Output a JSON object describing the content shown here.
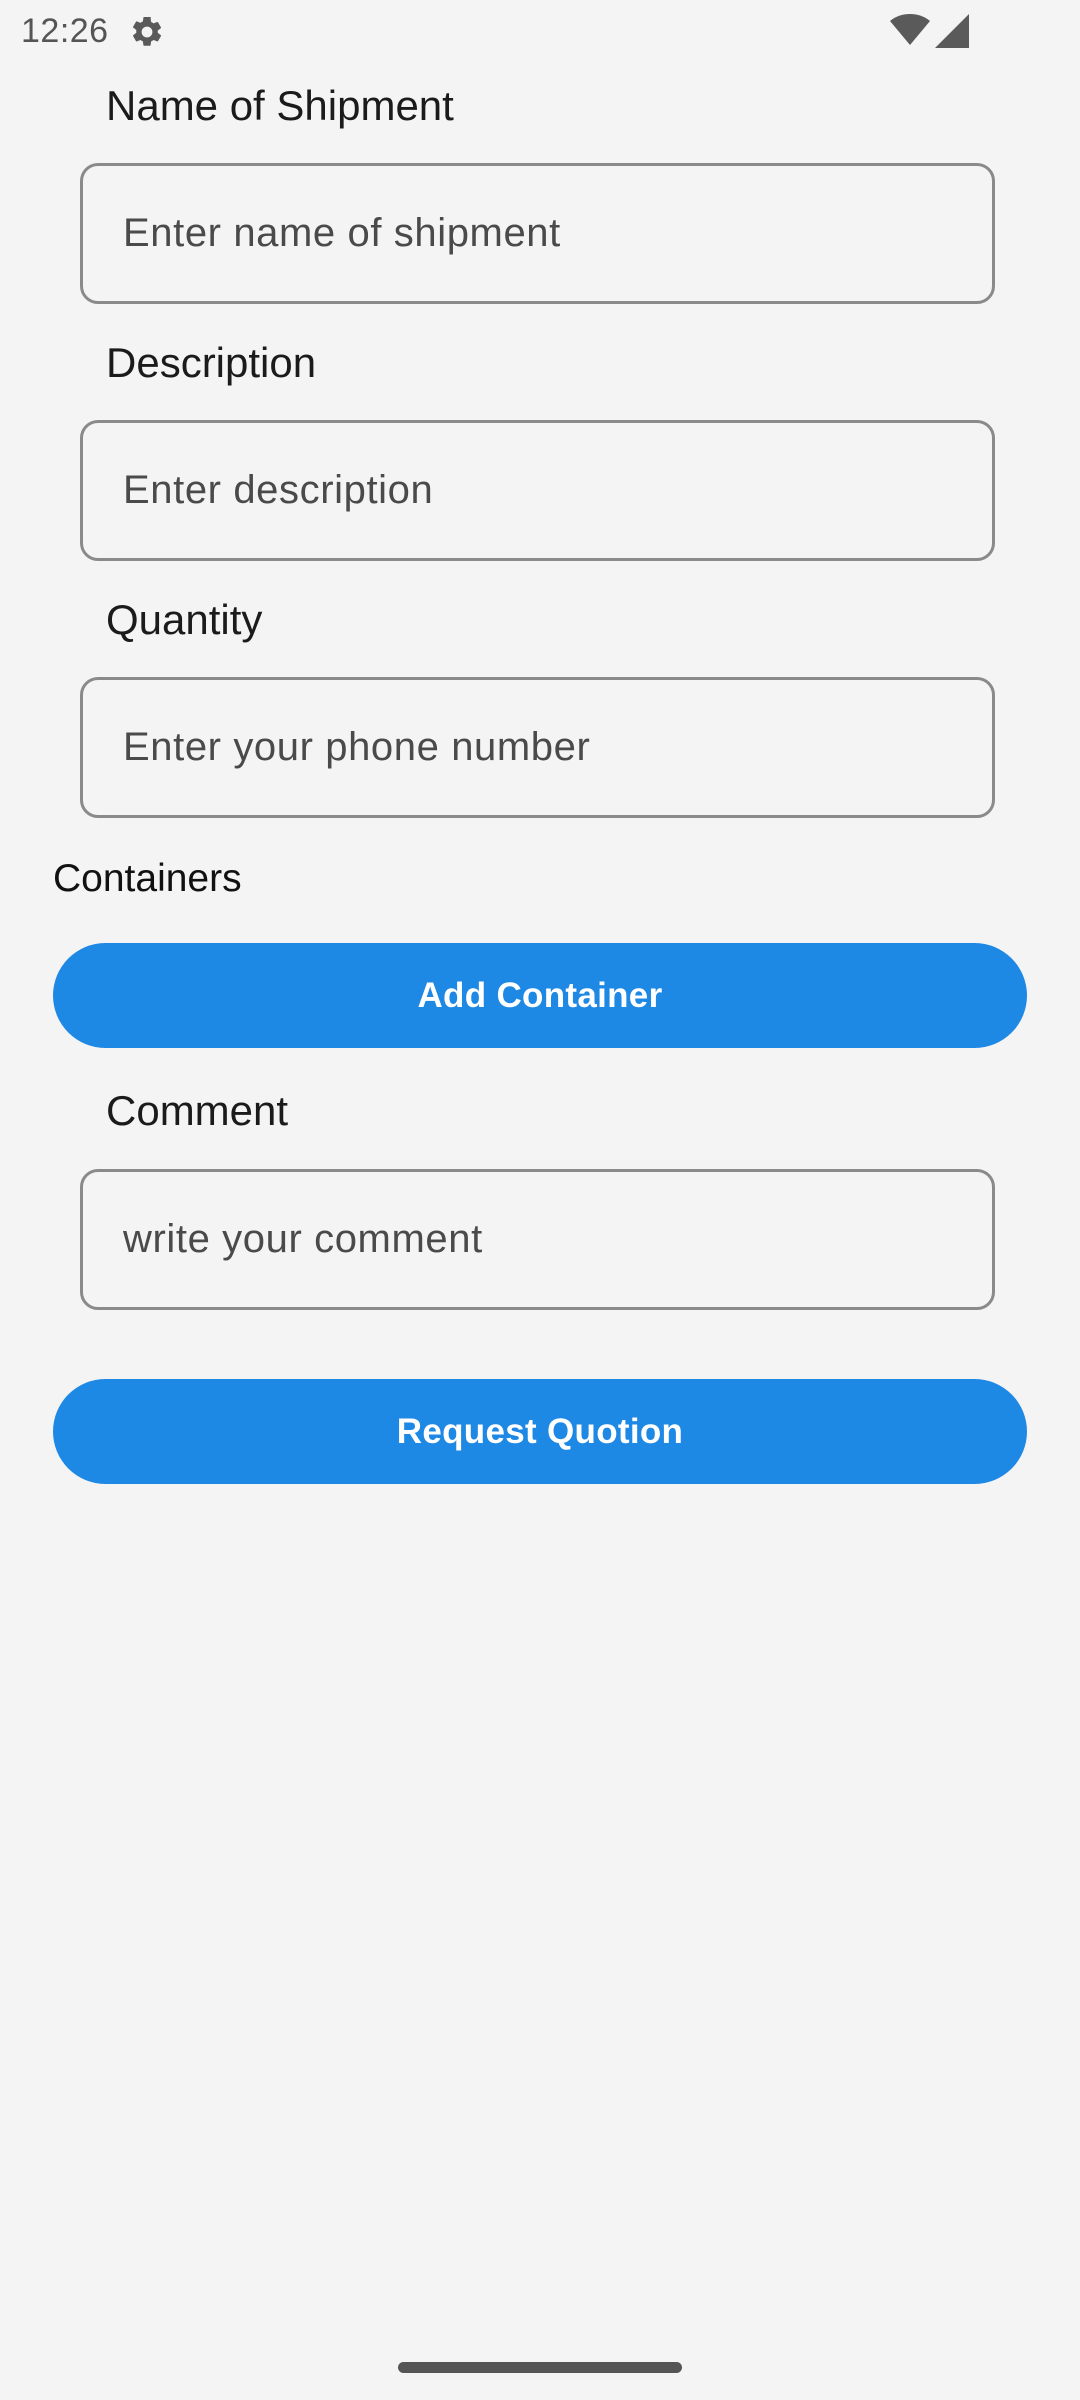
{
  "status_bar": {
    "time": "12:26",
    "icons": [
      "gear-icon",
      "wifi-icon",
      "cellular-signal-icon"
    ]
  },
  "form": {
    "shipment_name": {
      "label": "Name of Shipment",
      "placeholder": "Enter name of shipment",
      "value": ""
    },
    "description": {
      "label": "Description",
      "placeholder": "Enter description",
      "value": ""
    },
    "quantity": {
      "label": "Quantity",
      "placeholder": "Enter your phone number",
      "value": ""
    },
    "containers": {
      "label": "Containers",
      "add_button_label": "Add Container"
    },
    "comment": {
      "label": "Comment",
      "placeholder": "write your comment",
      "value": ""
    },
    "submit_button_label": "Request Quotion"
  },
  "colors": {
    "background": "#f4f4f4",
    "primary": "#1e88e5",
    "border": "#8a8a8a",
    "text": "#1b1b1b"
  }
}
